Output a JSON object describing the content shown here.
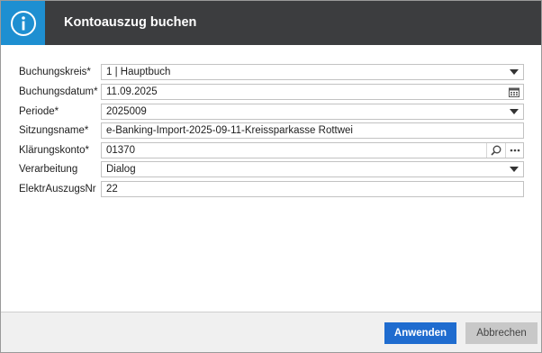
{
  "dialog": {
    "title": "Kontoauszug buchen",
    "icon": "info-icon",
    "accent_color": "#1e8fd1",
    "header_color": "#3c3d3f"
  },
  "form": {
    "buchungskreis": {
      "label": "Buchungskreis*",
      "value": "1  |  Hauptbuch"
    },
    "buchungsdatum": {
      "label": "Buchungsdatum*",
      "value": "11.09.2025"
    },
    "periode": {
      "label": "Periode*",
      "value": "2025009"
    },
    "sitzungsname": {
      "label": "Sitzungsname*",
      "value": "e-Banking-Import-2025-09-11-Kreissparkasse Rottwei"
    },
    "klaerungskonto": {
      "label": "Klärungskonto*",
      "value": "01370"
    },
    "verarbeitung": {
      "label": "Verarbeitung",
      "value": "Dialog"
    },
    "elektrauszugsnr": {
      "label": "ElektrAuszugsNr",
      "value": "22"
    }
  },
  "footer": {
    "apply_label": "Anwenden",
    "cancel_label": "Abbrechen",
    "primary_color": "#1f6ccf"
  }
}
